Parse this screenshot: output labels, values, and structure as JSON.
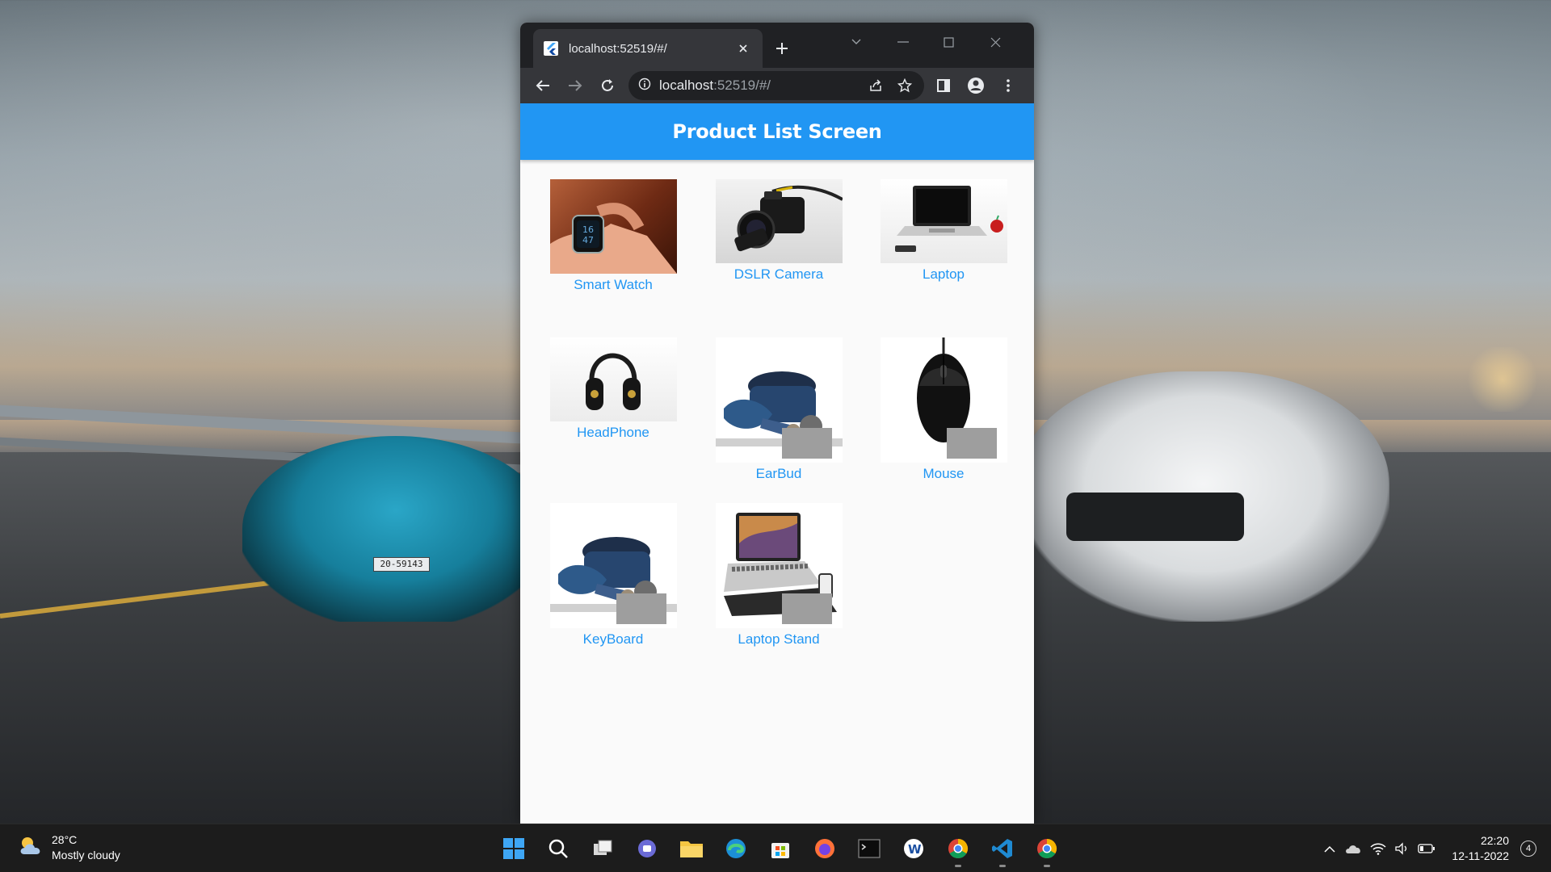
{
  "browser": {
    "tab_title": "localhost:52519/#/",
    "url_host": "localhost",
    "url_rest": ":52519/#/"
  },
  "app": {
    "title": "Product List Screen",
    "accent_color": "#2196f3",
    "products": [
      {
        "name": "Smart Watch",
        "icon": "smart-watch-image"
      },
      {
        "name": "DSLR Camera",
        "icon": "dslr-camera-image"
      },
      {
        "name": "Laptop",
        "icon": "laptop-image"
      },
      {
        "name": "HeadPhone",
        "icon": "headphone-image"
      },
      {
        "name": "EarBud",
        "icon": "earbud-image"
      },
      {
        "name": "Mouse",
        "icon": "mouse-image"
      },
      {
        "name": "KeyBoard",
        "icon": "keyboard-image"
      },
      {
        "name": "Laptop Stand",
        "icon": "laptop-stand-image"
      }
    ]
  },
  "wallpaper": {
    "plate_text": "20-59143"
  },
  "taskbar": {
    "weather_temp": "28°C",
    "weather_desc": "Mostly cloudy",
    "time": "22:20",
    "date": "12-11-2022",
    "notification_count": "4",
    "apps": [
      "start",
      "search",
      "task-view",
      "teams-chat",
      "file-explorer",
      "edge",
      "microsoft-store",
      "firefox",
      "terminal",
      "word",
      "chrome",
      "vscode",
      "chrome"
    ]
  }
}
